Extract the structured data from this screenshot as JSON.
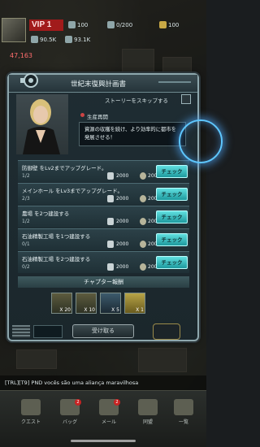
{
  "hud": {
    "vip": "VIP 1",
    "res1": "100",
    "res2": "0/200",
    "res3": "100",
    "res4": "90.5K",
    "res5": "93.1K",
    "power": "47,163"
  },
  "modal": {
    "title": "世紀末復興計画書",
    "skip_label": "ストーリーをスキップする",
    "chapter_name": "生産再開",
    "story": "資源の収穫を続け、より効率的に都市を発展させる！",
    "quests": [
      {
        "text": "防御壁 をLv2までアップグレード。",
        "progress": "1/2",
        "reward1": "2000",
        "reward2": "2000",
        "button": "チェック"
      },
      {
        "text": "メインホール をLv3までアップグレード。",
        "progress": "2/3",
        "reward1": "2000",
        "reward2": "2000",
        "button": "チェック"
      },
      {
        "text": "農場 を2つ建設する",
        "progress": "1/2",
        "reward1": "2000",
        "reward2": "2000",
        "button": "チェック"
      },
      {
        "text": "石油精製工場 を1つ建設する",
        "progress": "0/1",
        "reward1": "2000",
        "reward2": "2000",
        "button": "チェック"
      },
      {
        "text": "石油精製工場 を2つ建設する",
        "progress": "0/2",
        "reward1": "2000",
        "reward2": "2000",
        "button": "チェック"
      }
    ],
    "reward_heading": "チャプター報酬",
    "rewards": [
      {
        "icon": "speedup-5min-icon",
        "count": "X 20"
      },
      {
        "icon": "supply-crate-icon",
        "count": "X 10"
      },
      {
        "icon": "troop-recruit-icon",
        "count": "X 5"
      },
      {
        "icon": "gold-bar-icon",
        "count": "X 1"
      }
    ],
    "claim_label": "受け取る"
  },
  "chat": {
    "text": "[TRL][T9] PND vocês são uma aliança maravilhosa"
  },
  "nav": {
    "items": [
      {
        "label": "クエスト",
        "badge": ""
      },
      {
        "label": "バッグ",
        "badge": "2"
      },
      {
        "label": "メール",
        "badge": "2"
      },
      {
        "label": "同盟",
        "badge": ""
      },
      {
        "label": "一覧",
        "badge": ""
      }
    ]
  },
  "colors": {
    "accent_button": "#3fc6c8",
    "panel": "#1f2d33",
    "vip_red": "#a11b1b"
  }
}
